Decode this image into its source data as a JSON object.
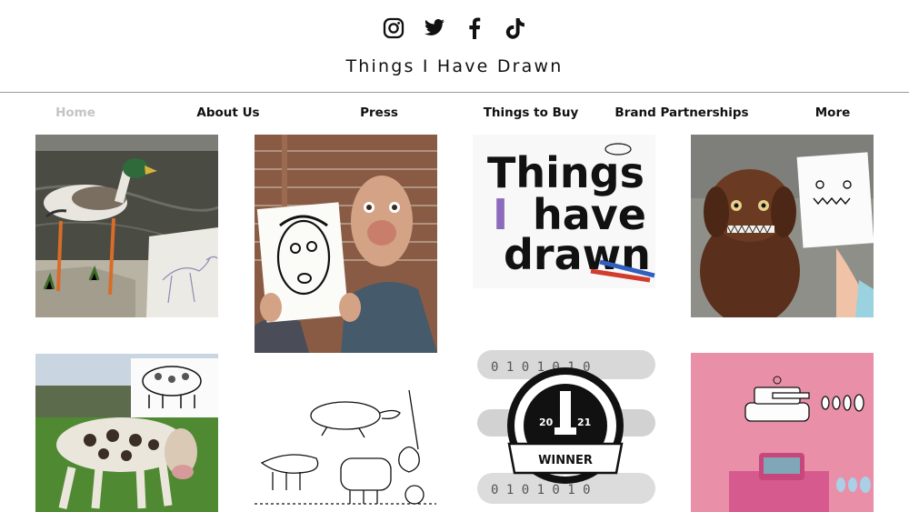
{
  "social": {
    "icons": [
      "instagram-icon",
      "twitter-icon",
      "facebook-icon",
      "tiktok-icon"
    ]
  },
  "site": {
    "title": "Things I Have Drawn"
  },
  "nav": {
    "items": [
      {
        "label": "Home",
        "active": true
      },
      {
        "label": "About Us",
        "active": false
      },
      {
        "label": "Press",
        "active": false
      },
      {
        "label": "Things to Buy",
        "active": false
      },
      {
        "label": "Brand Partnerships",
        "active": false
      },
      {
        "label": "More",
        "active": false
      }
    ]
  },
  "gallery": {
    "logo_text": {
      "line1": "Things",
      "line2_a": "I",
      "line2_b": "have",
      "line3": "drawn"
    },
    "award": {
      "year_left": "20",
      "year_right": "21",
      "banner": "WINNER",
      "digits": "0 1 0 1 0 1 0"
    }
  },
  "colors": {
    "nav_active": "#c4c4c4",
    "pink_tile": "#e98fa8",
    "logo_purple": "#8c6bbd"
  }
}
